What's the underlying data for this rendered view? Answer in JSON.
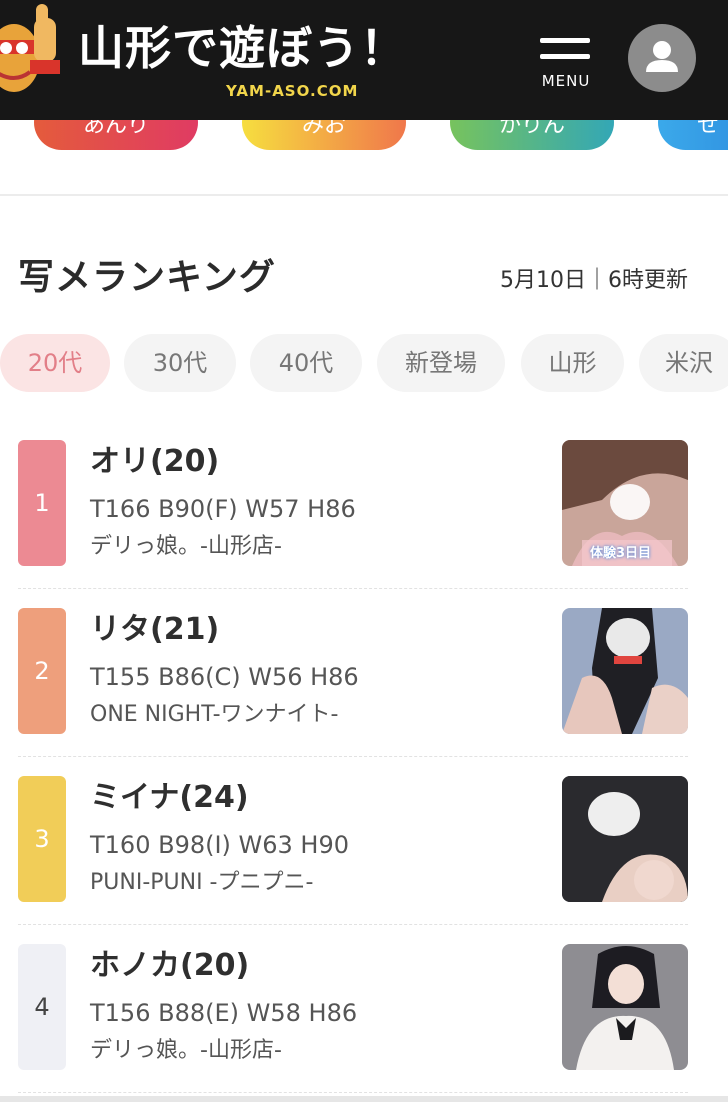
{
  "header": {
    "logo_title": "山形で遊ぼう！",
    "logo_sub": "YAM-ASO.COM",
    "menu_label": "MENU"
  },
  "pills": [
    {
      "label": "あんり",
      "from": "#e45b3c",
      "to": "#e03b63"
    },
    {
      "label": "みお",
      "from": "#f6de3f",
      "to": "#f0774b"
    },
    {
      "label": "かりん",
      "from": "#77c35d",
      "to": "#33a7b6"
    },
    {
      "label": "せ",
      "from": "#3ba9ea",
      "to": "#2f8fe0"
    }
  ],
  "ranking": {
    "title": "写メランキング",
    "date": "5月10日｜6時更新"
  },
  "filters": [
    {
      "label": "20代",
      "active": true
    },
    {
      "label": "30代",
      "active": false
    },
    {
      "label": "40代",
      "active": false
    },
    {
      "label": "新登場",
      "active": false
    },
    {
      "label": "山形",
      "active": false
    },
    {
      "label": "米沢",
      "active": false
    }
  ],
  "items": [
    {
      "rank": "1",
      "name": "オリ(20)",
      "spec": "T166 B90(F) W57 H86",
      "shop": "デリっ娘。-山形店-",
      "badge_color": "#ec8a93",
      "thumb_caption": "体験3日目"
    },
    {
      "rank": "2",
      "name": "リタ(21)",
      "spec": "T155 B86(C) W56 H86",
      "shop": "ONE NIGHT-ワンナイト-",
      "badge_color": "#ee9f7c"
    },
    {
      "rank": "3",
      "name": "ミイナ(24)",
      "spec": "T160 B98(I) W63 H90",
      "shop": "PUNI-PUNI -プニプニ-",
      "badge_color": "#f1cd58"
    },
    {
      "rank": "4",
      "name": "ホノカ(20)",
      "spec": "T156 B88(E) W58 H86",
      "shop": "デリっ娘。-山形店-",
      "badge_color": "#eff0f5"
    }
  ]
}
